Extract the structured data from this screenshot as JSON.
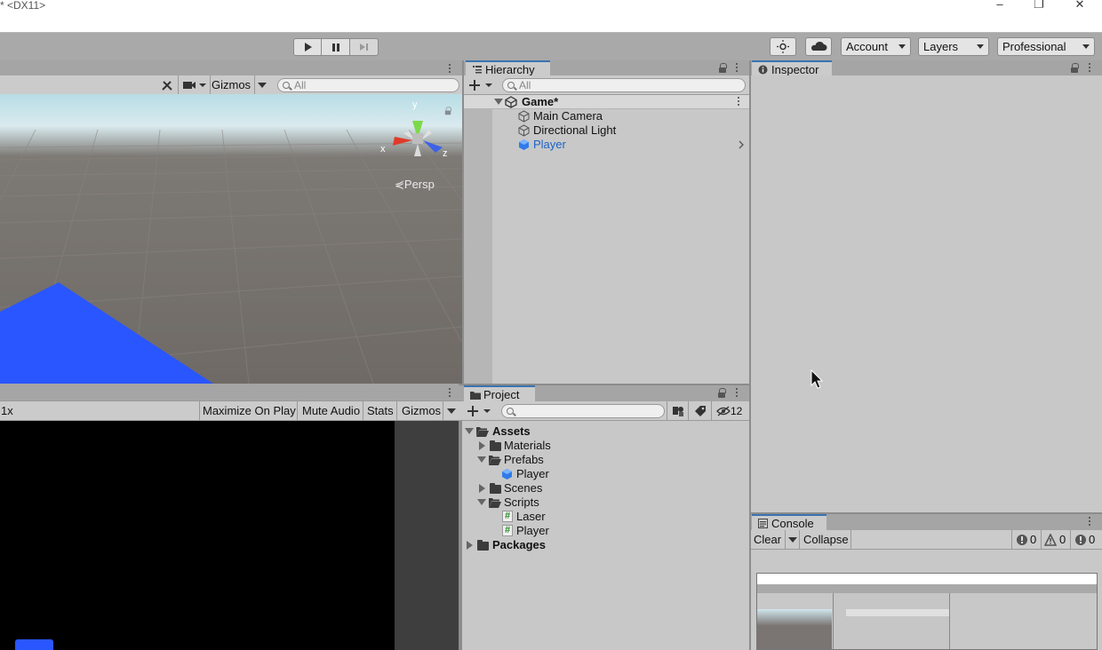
{
  "window": {
    "title": "* <DX11>",
    "minimize": "–",
    "restore": "❐",
    "close": "✕"
  },
  "toolbar": {
    "account_label": "Account",
    "layers_label": "Layers",
    "layout_label": "Professional"
  },
  "scene": {
    "gizmos_label": "Gizmos",
    "search_placeholder": "All",
    "persp_label": "Persp",
    "axis_x": "x",
    "axis_y": "y",
    "axis_z": "z"
  },
  "game": {
    "scale_label": "1x",
    "maximize_label": "Maximize On Play",
    "mute_label": "Mute Audio",
    "stats_label": "Stats",
    "gizmos_label": "Gizmos"
  },
  "hierarchy": {
    "tab_label": "Hierarchy",
    "search_placeholder": "All",
    "scene_name": "Game*",
    "items": [
      {
        "label": "Main Camera",
        "selected": false
      },
      {
        "label": "Directional Light",
        "selected": false
      },
      {
        "label": "Player",
        "selected": true
      }
    ]
  },
  "project": {
    "tab_label": "Project",
    "hidden_count": "12",
    "tree": [
      {
        "label": "Assets",
        "bold": true
      },
      {
        "label": "Materials"
      },
      {
        "label": "Prefabs"
      },
      {
        "label": "Player"
      },
      {
        "label": "Scenes"
      },
      {
        "label": "Scripts"
      },
      {
        "label": "Laser"
      },
      {
        "label": "Player"
      },
      {
        "label": "Packages",
        "bold": true
      }
    ]
  },
  "inspector": {
    "tab_label": "Inspector"
  },
  "console": {
    "tab_label": "Console",
    "clear_label": "Clear",
    "collapse_label": "Collapse",
    "info_count": "0",
    "warn_count": "0",
    "error_count": "0"
  },
  "colors": {
    "accent": "#3a72b0",
    "selected_text": "#1d62c7",
    "player_blue": "#2a56ff"
  }
}
